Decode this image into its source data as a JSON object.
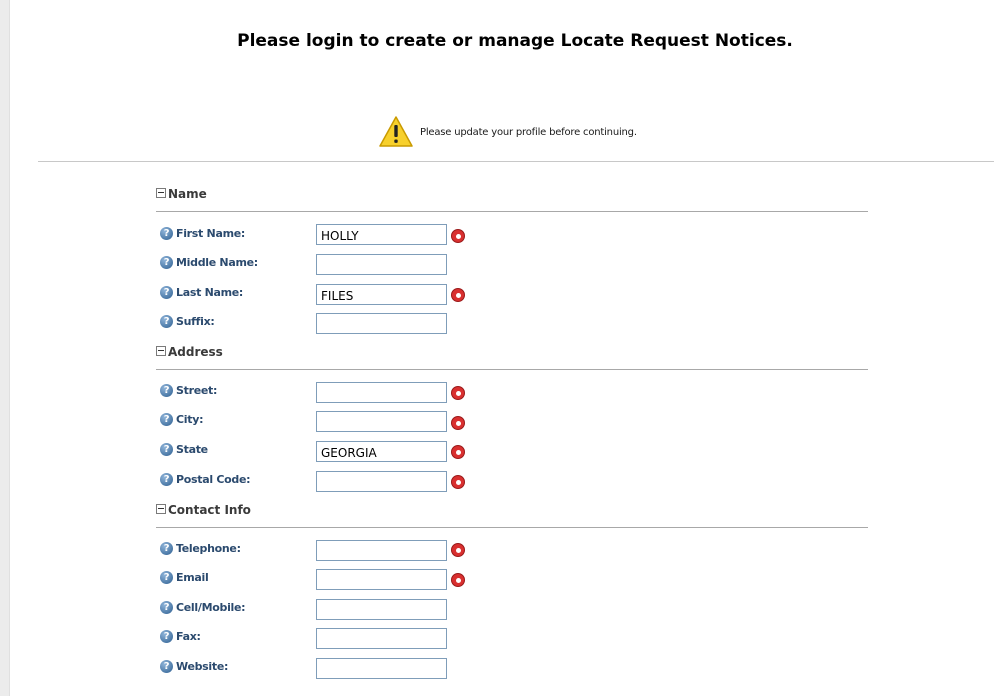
{
  "page": {
    "heading": "Please login to create or manage Locate Request Notices.",
    "notice_text": "Please update your profile before continuing.",
    "notice_icon": "warning-icon",
    "help_icon": "question-icon",
    "required_icon": "required-arrow-icon"
  },
  "sections": {
    "name": {
      "label": "Name"
    },
    "address": {
      "label": "Address"
    },
    "contact": {
      "label": "Contact Info"
    }
  },
  "fields": {
    "first_name": {
      "label": "First Name:",
      "value": "HOLLY",
      "required": true
    },
    "middle_name": {
      "label": "Middle Name:",
      "value": "",
      "required": false
    },
    "last_name": {
      "label": "Last Name:",
      "value": "FILES",
      "required": true
    },
    "suffix": {
      "label": "Suffix:",
      "value": "",
      "required": false
    },
    "street": {
      "label": "Street:",
      "value": "",
      "required": true
    },
    "city": {
      "label": "City:",
      "value": "",
      "required": true
    },
    "state": {
      "label": "State",
      "value": "GEORGIA",
      "required": true
    },
    "postal_code": {
      "label": "Postal Code:",
      "value": "",
      "required": true
    },
    "telephone": {
      "label": "Telephone:",
      "value": "",
      "required": true
    },
    "email": {
      "label": "Email",
      "value": "",
      "required": true
    },
    "cell_mobile": {
      "label": "Cell/Mobile:",
      "value": "",
      "required": false
    },
    "fax": {
      "label": "Fax:",
      "value": "",
      "required": false
    },
    "website": {
      "label": "Website:",
      "value": "",
      "required": false
    }
  },
  "colors": {
    "label_blue": "#2b4a6e",
    "required_red": "#d93030",
    "warning_yellow": "#f2c200",
    "input_border": "#7f9db9"
  }
}
